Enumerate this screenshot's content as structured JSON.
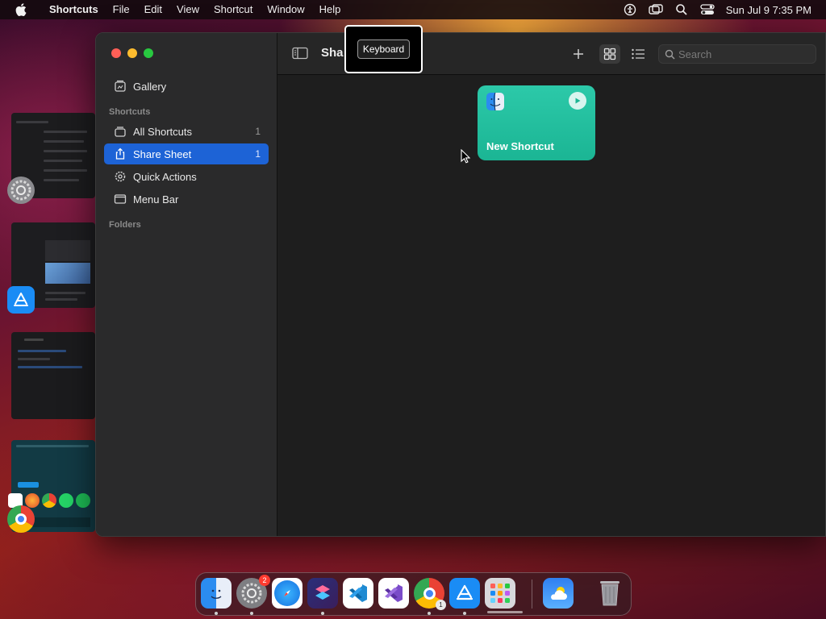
{
  "menubar": {
    "app_name": "Shortcuts",
    "items": [
      "File",
      "Edit",
      "View",
      "Shortcut",
      "Window",
      "Help"
    ],
    "datetime": "Sun Jul 9  7:35 PM",
    "status_icons": [
      "accessibility-icon",
      "screen-mirroring-icon",
      "spotlight-search-icon",
      "control-center-icon"
    ]
  },
  "sidebar": {
    "gallery_label": "Gallery",
    "shortcuts_header": "Shortcuts",
    "items": [
      {
        "label": "All Shortcuts",
        "count": "1",
        "icon": "stack-icon"
      },
      {
        "label": "Share Sheet",
        "count": "1",
        "icon": "share-icon",
        "selected": true
      },
      {
        "label": "Quick Actions",
        "count": "",
        "icon": "gear-icon"
      },
      {
        "label": "Menu Bar",
        "count": "",
        "icon": "menu-bar-icon"
      }
    ],
    "folders_header": "Folders"
  },
  "toolbar": {
    "title_partial": "Sha",
    "search_placeholder": "Search"
  },
  "tooltip": {
    "text": "Keyboard"
  },
  "shortcut_card": {
    "name": "New Shortcut",
    "color": "#22bf9e"
  },
  "dock": {
    "apps": [
      "Finder",
      "System Settings",
      "Safari",
      "Shortcuts",
      "Visual Studio Code",
      "Visual Studio",
      "Google Chrome",
      "App Store",
      "Launchpad",
      "Weather",
      "Trash"
    ],
    "system_settings_badge": "2",
    "chrome_windows": "1"
  },
  "colors": {
    "selection_blue": "#1d63d6",
    "card_teal": "#22bf9e"
  }
}
